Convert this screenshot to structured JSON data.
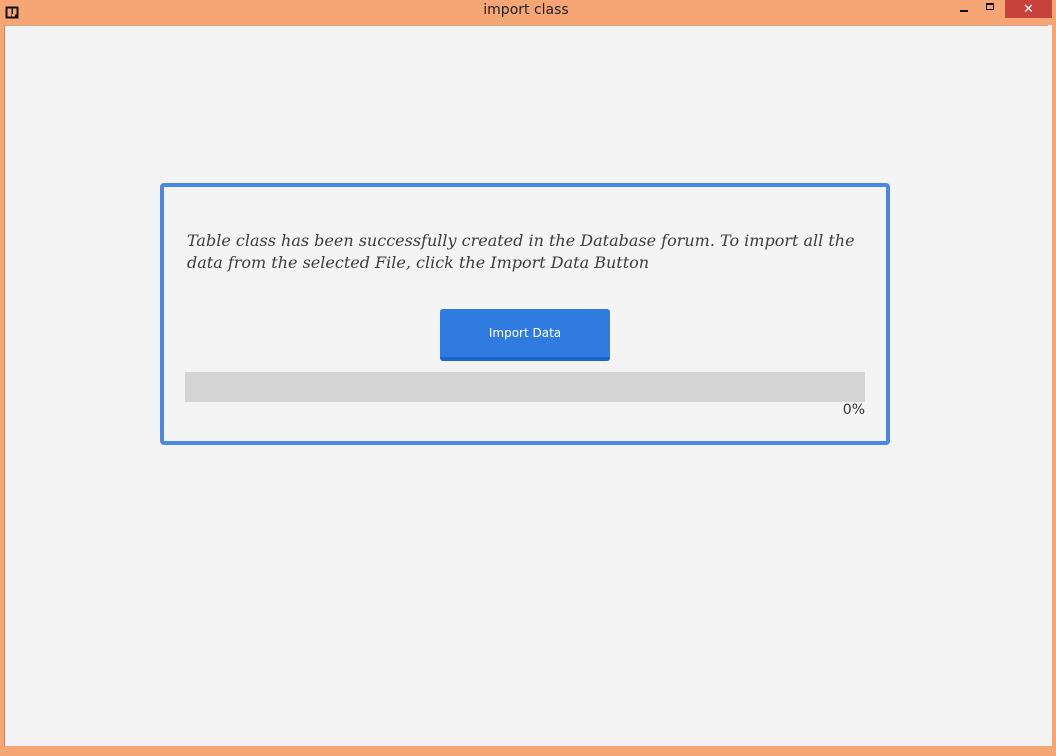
{
  "window": {
    "title": "import class",
    "close_symbol": "✕",
    "icon": "app-logo-icon",
    "frame_color": "#f6a674",
    "close_color": "#c7423a"
  },
  "panel": {
    "message": "Table class has been successfully created in the Database forum. To import all the data from the selected File, click the Import Data Button",
    "import_button_label": "Import Data",
    "accent_color": "#2f7be0",
    "progress": {
      "value": 0,
      "label": "0%"
    }
  }
}
